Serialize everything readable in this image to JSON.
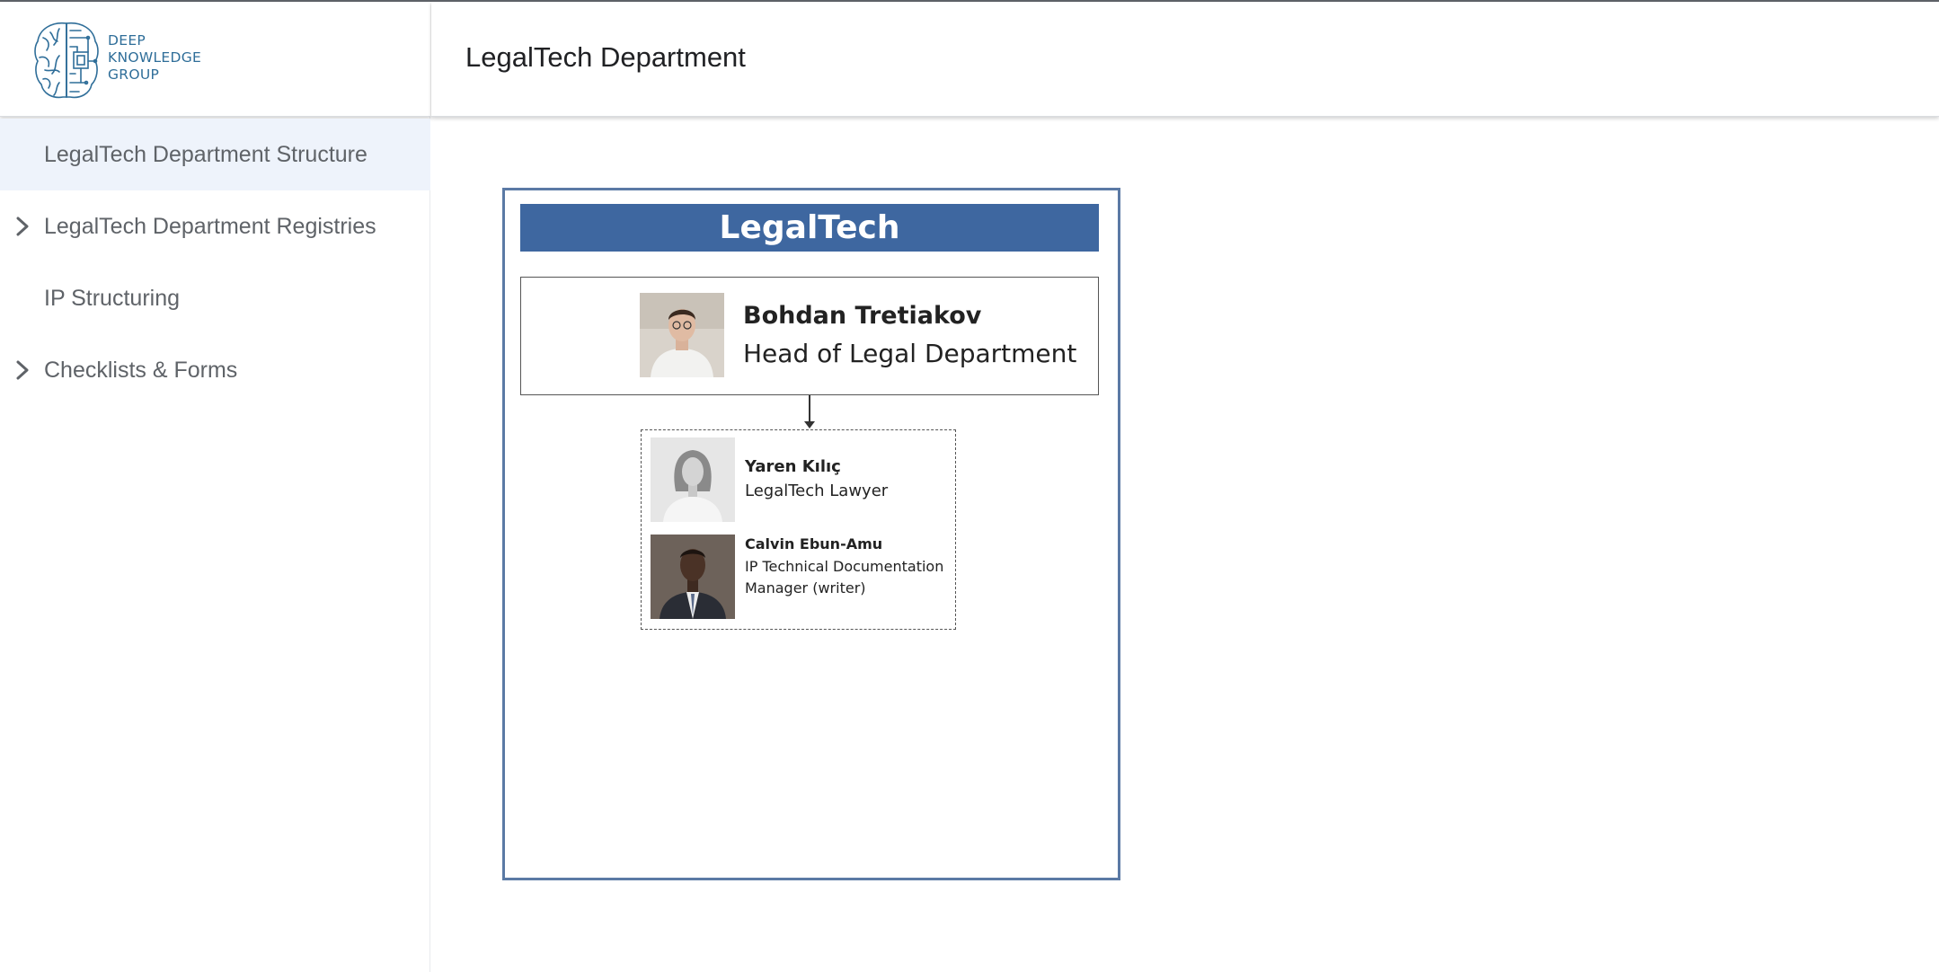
{
  "logo": {
    "line1": "DEEP",
    "line2": "KNOWLEDGE",
    "line3": "GROUP",
    "brand_color": "#2f6e99"
  },
  "header": {
    "title": "LegalTech Department"
  },
  "sidebar": {
    "items": [
      {
        "label": "LegalTech Department Structure",
        "active": true,
        "expandable": false
      },
      {
        "label": "LegalTech Department Registries",
        "active": false,
        "expandable": true,
        "icon": "chevron-right-icon"
      },
      {
        "label": "IP Structuring",
        "active": false,
        "expandable": false
      },
      {
        "label": "Checklists & Forms",
        "active": false,
        "expandable": true,
        "icon": "chevron-right-icon"
      }
    ]
  },
  "org_chart": {
    "banner": "LegalTech",
    "banner_color": "#3e67a0",
    "head": {
      "name": "Bohdan Tretiakov",
      "role": "Head of Legal Department"
    },
    "members": [
      {
        "name": "Yaren Kılıç",
        "role": "LegalTech Lawyer"
      },
      {
        "name": "Calvin Ebun-Amu",
        "role": "IP Technical Documentation Manager (writer)"
      }
    ]
  }
}
